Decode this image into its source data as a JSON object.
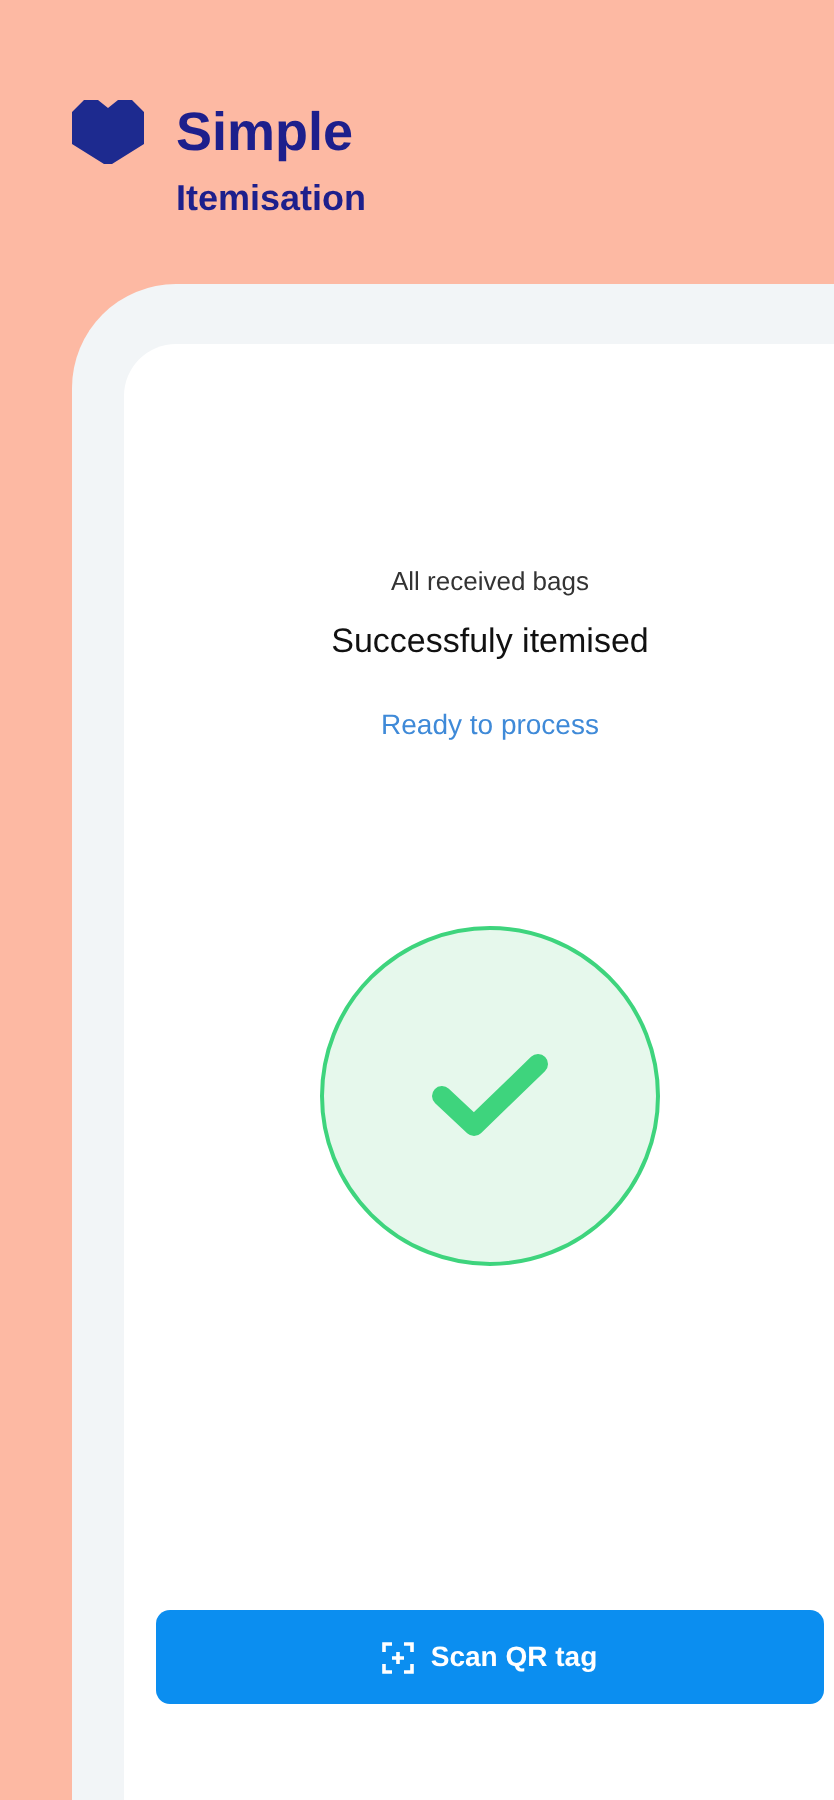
{
  "brand": {
    "name": "Simple",
    "subtitle": "Itemisation"
  },
  "status": {
    "caption": "All received bags",
    "title": "Successfuly itemised",
    "link": "Ready to process",
    "success": true
  },
  "button": {
    "label": "Scan QR tag"
  }
}
